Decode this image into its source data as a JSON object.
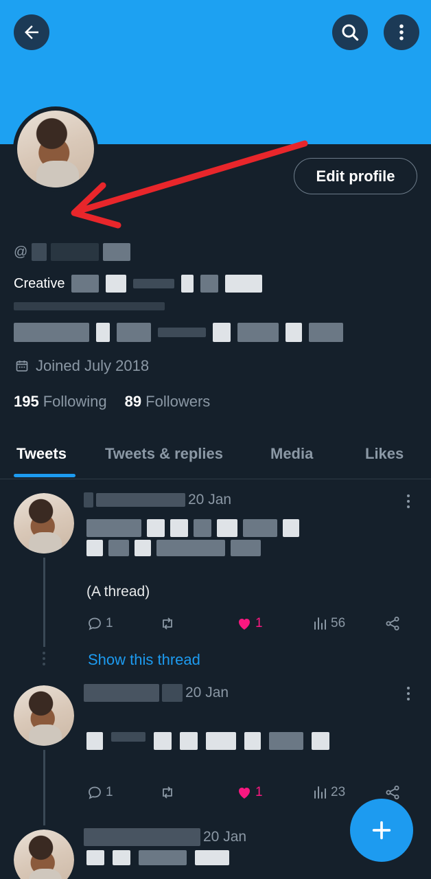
{
  "profile": {
    "handle_prefix": "@",
    "edit_profile_label": "Edit profile",
    "bio_first_word": "Creative",
    "joined": "Joined July 2018",
    "following_count": "195",
    "following_label": "Following",
    "followers_count": "89",
    "followers_label": "Followers"
  },
  "tabs": [
    {
      "label": "Tweets"
    },
    {
      "label": "Tweets & replies"
    },
    {
      "label": "Media"
    },
    {
      "label": "Likes"
    }
  ],
  "tweets": [
    {
      "date": "20 Jan",
      "extra_text": "(A thread)",
      "replies": "1",
      "likes": "1",
      "views": "56",
      "show_thread": "Show this thread"
    },
    {
      "date": "20 Jan",
      "replies": "1",
      "likes": "1",
      "views": "23"
    },
    {
      "date": "20 Jan"
    }
  ],
  "colors": {
    "banner": "#1da1f2",
    "background": "#15202b",
    "accent": "#1d9bf0",
    "like": "#f91880",
    "annotation_arrow": "#e8262b"
  },
  "icons": [
    "back-arrow-icon",
    "search-icon",
    "more-vertical-icon",
    "calendar-icon",
    "reply-icon",
    "retweet-icon",
    "heart-icon",
    "views-icon",
    "share-icon",
    "plus-icon"
  ]
}
